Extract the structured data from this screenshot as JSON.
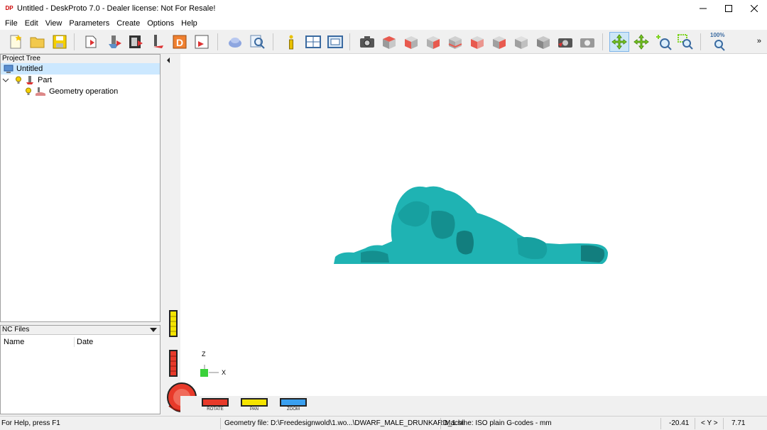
{
  "window": {
    "title": "Untitled - DeskProto 7.0 - Dealer license: Not For Resale!",
    "logo_text": "DP"
  },
  "menu": [
    "File",
    "Edit",
    "View",
    "Parameters",
    "Create",
    "Options",
    "Help"
  ],
  "toolbar": {
    "zoom_label": "100%"
  },
  "project_tree": {
    "header": "Project Tree",
    "items": [
      {
        "label": "Untitled",
        "level": 0
      },
      {
        "label": "Part",
        "level": 1
      },
      {
        "label": "Geometry operation",
        "level": 2
      }
    ]
  },
  "nc_files": {
    "header": "NC Files",
    "columns": [
      "Name",
      "Date"
    ]
  },
  "viewport": {
    "axis_z": "Z",
    "axis_x": "X",
    "model_color": "#1fb3b3",
    "controls": [
      "ROTATE",
      "PAN",
      "ZOOM"
    ]
  },
  "status": {
    "help": "For Help, press F1",
    "geometry_file": "Geometry file: D:\\Freedesignwold\\1.wo...\\DWARF_MALE_DRUNKARD_1.stl",
    "machine": "Machine: ISO plain G-codes - mm",
    "coord_left": "-20.41",
    "coord_axis": "< Y >",
    "coord_right": "7.71"
  }
}
